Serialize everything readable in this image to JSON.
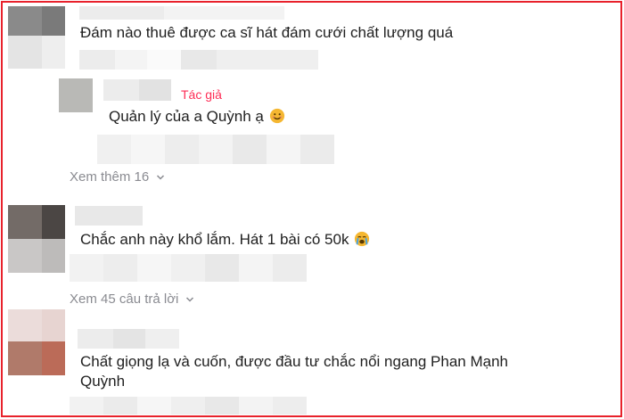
{
  "comments": [
    {
      "text": "Đám nào thuê được ca sĩ hát đám cưới chất lượng quá",
      "replies_link": "Xem thêm 16",
      "reply": {
        "author_badge": "Tác giả",
        "text": "Quản lý của a Quỳnh ạ",
        "emoji": "smiling-face-emoji"
      }
    },
    {
      "text": "Chắc anh này khổ lắm. Hát 1 bài có 50k",
      "emoji": "crying-face-emoji",
      "replies_link": "Xem 45 câu trả lời"
    },
    {
      "text_line1": "Chất giọng lạ và cuốn, được đầu tư chắc nổi ngang Phan Mạnh",
      "text_line2": "Quỳnh"
    }
  ],
  "icons": {
    "chevron": "chevron-down-icon"
  },
  "colors": {
    "frame": "#e8212b",
    "author_badge": "#fe2c55",
    "muted_text": "#8a8b91"
  }
}
